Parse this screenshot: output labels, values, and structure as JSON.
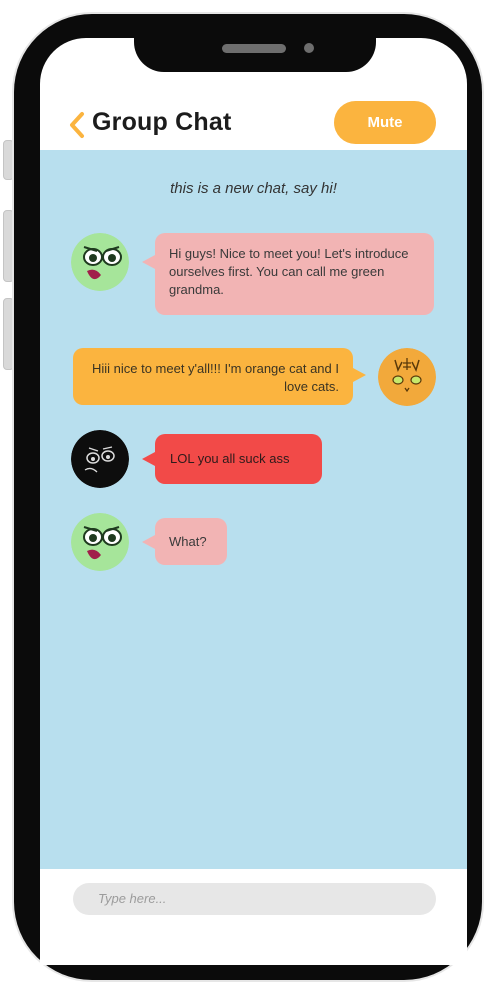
{
  "header": {
    "title": "Group Chat",
    "mute_label": "Mute"
  },
  "intro_text": "this is a new chat, say hi!",
  "messages": [
    {
      "sender": "green grandma",
      "side": "left",
      "color": "#f2b4b4",
      "text": "Hi guys! Nice to meet you! Let's introduce ourselves first. You can call me green grandma."
    },
    {
      "sender": "orange cat",
      "side": "right",
      "color": "#fbb43f",
      "text": "Hiii nice to meet y'all!!! I'm orange cat and I love cats."
    },
    {
      "sender": "black",
      "side": "left",
      "color": "#f24a48",
      "text": "LOL you all suck ass"
    },
    {
      "sender": "green grandma",
      "side": "left",
      "color": "#f2b4b4",
      "text": "What?"
    }
  ],
  "input": {
    "placeholder": "Type here..."
  },
  "colors": {
    "accent": "#fbb43f",
    "chat_background": "#b8dfee",
    "pink_bubble": "#f2b4b4",
    "red_bubble": "#f24a48"
  }
}
